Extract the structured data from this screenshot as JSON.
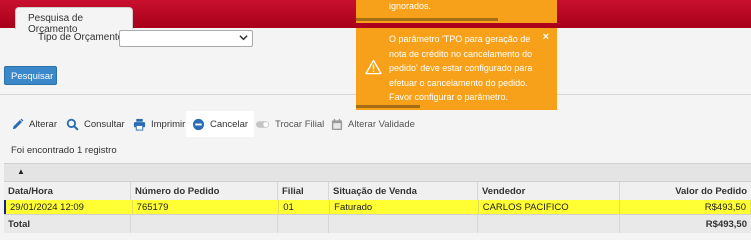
{
  "header": {
    "tab_label": "Pesquisa de Orçamento"
  },
  "filters": {
    "tipo_label": "Tipo de Orçamento",
    "tipo_value": "",
    "search_button": "Pesquisar"
  },
  "toolbar": {
    "alterar": "Alterar",
    "consultar": "Consultar",
    "imprimir": "Imprimir",
    "cancelar": "Cancelar",
    "trocar_filial": "Trocar Filial",
    "alterar_validade": "Alterar Validade"
  },
  "result_count": "Foi encontrado 1 registro",
  "grid": {
    "sort_arrow": "▲",
    "columns": [
      "Data/Hora",
      "Número do Pedido",
      "Filial",
      "Situação de Venda",
      "Vendedor",
      "Valor do Pedido"
    ],
    "rows": [
      [
        "29/01/2024 12:09",
        "765179",
        "01",
        "Faturado",
        "CARLOS PACIFICO",
        "R$493,50"
      ]
    ],
    "total_label": "Total",
    "total_value": "R$493,50"
  },
  "toasts": {
    "previous_message": "ignorados.",
    "main_message": "O parâmetro 'TPO para geração de nota de crédito no cancelamento do pedido' deve estar configurado para efetuar o cancelamento do pedido. Favor configurar o parâmetro.",
    "close_glyph": "×"
  },
  "colors": {
    "topbar": "#c8102e",
    "toast": "#f7a11a",
    "highlight_row": "#ffff33",
    "primary_button": "#3a87c9",
    "toolbar_icon": "#2a6db5"
  }
}
